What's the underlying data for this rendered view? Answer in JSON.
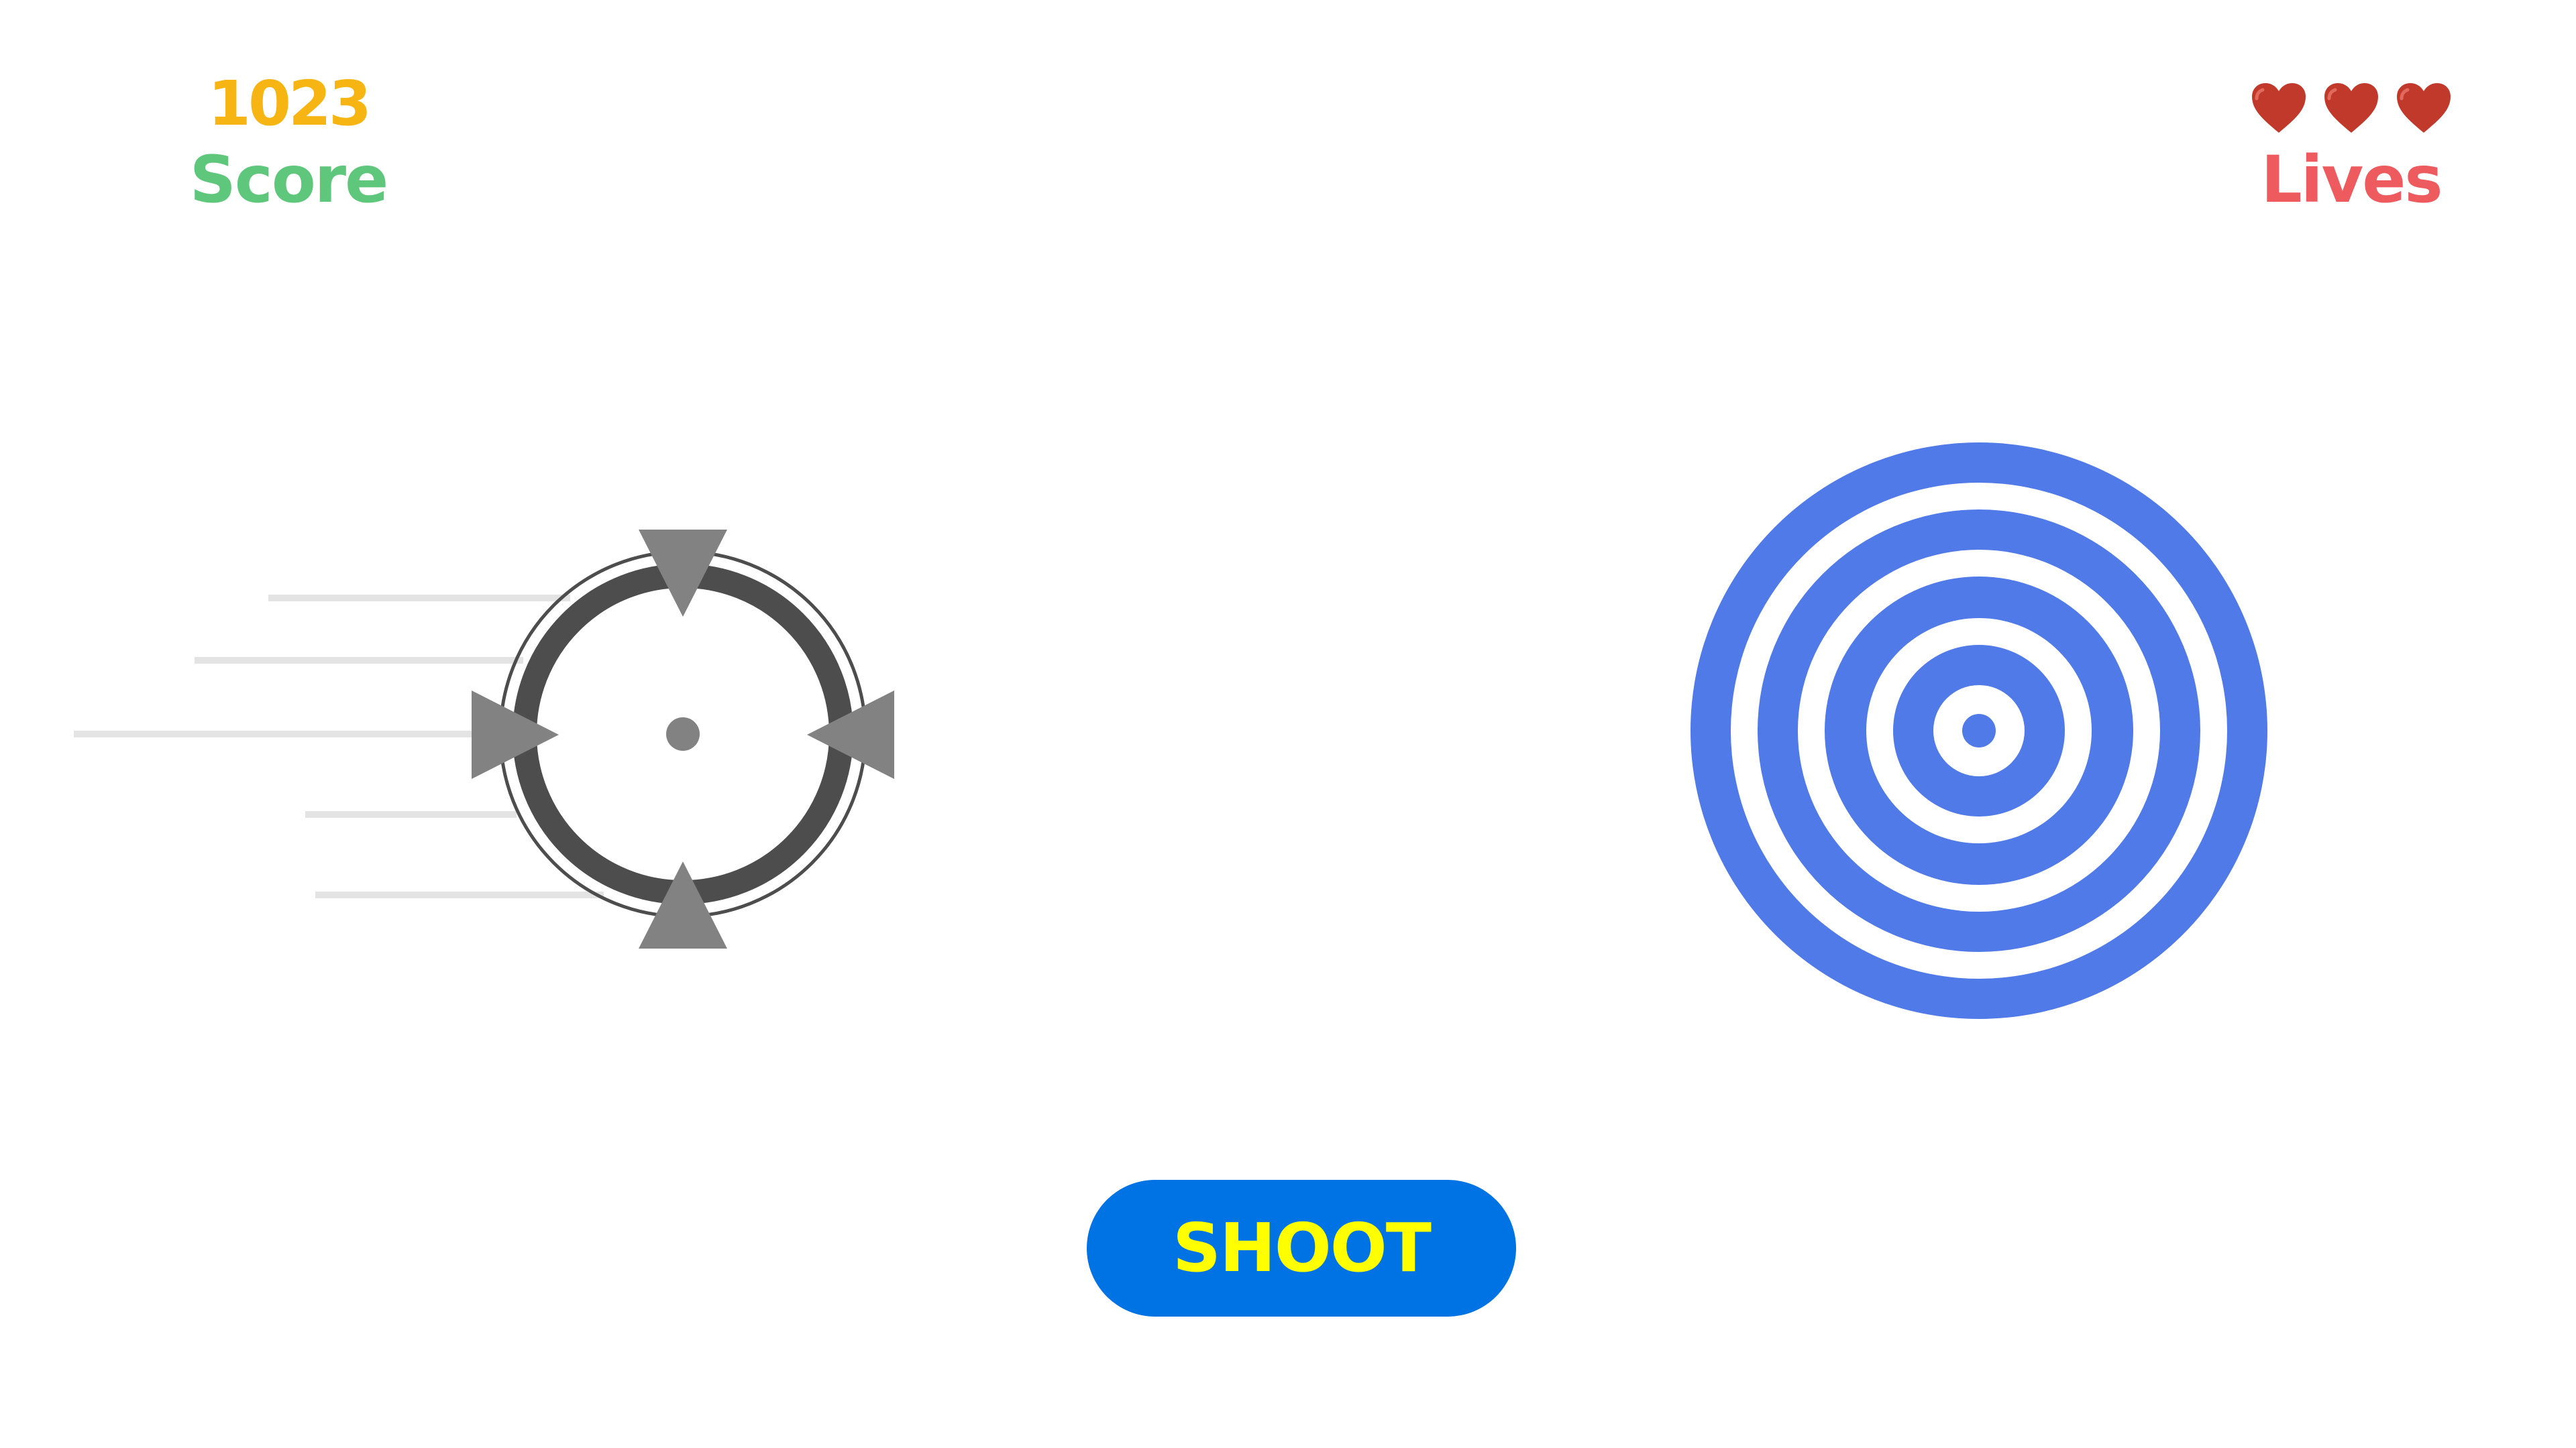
{
  "hud": {
    "score_value": "1023",
    "score_label": "Score",
    "lives_label": "Lives",
    "lives_count": 3,
    "heart_icon": "heart-icon"
  },
  "colors": {
    "score_value": "#f6b513",
    "score_label": "#5fc77b",
    "lives_label": "#ee5b5e",
    "heart": "#c0392b",
    "crosshair_ring": "#4d4d4d",
    "crosshair_arrow": "#828282",
    "motion_line": "#e3e3e3",
    "target_ring": "#4f7ae8",
    "button_bg": "#0073e4",
    "button_text": "#ffff00"
  },
  "controls": {
    "shoot_label": "SHOOT"
  },
  "target": {
    "ring_count": 5
  }
}
